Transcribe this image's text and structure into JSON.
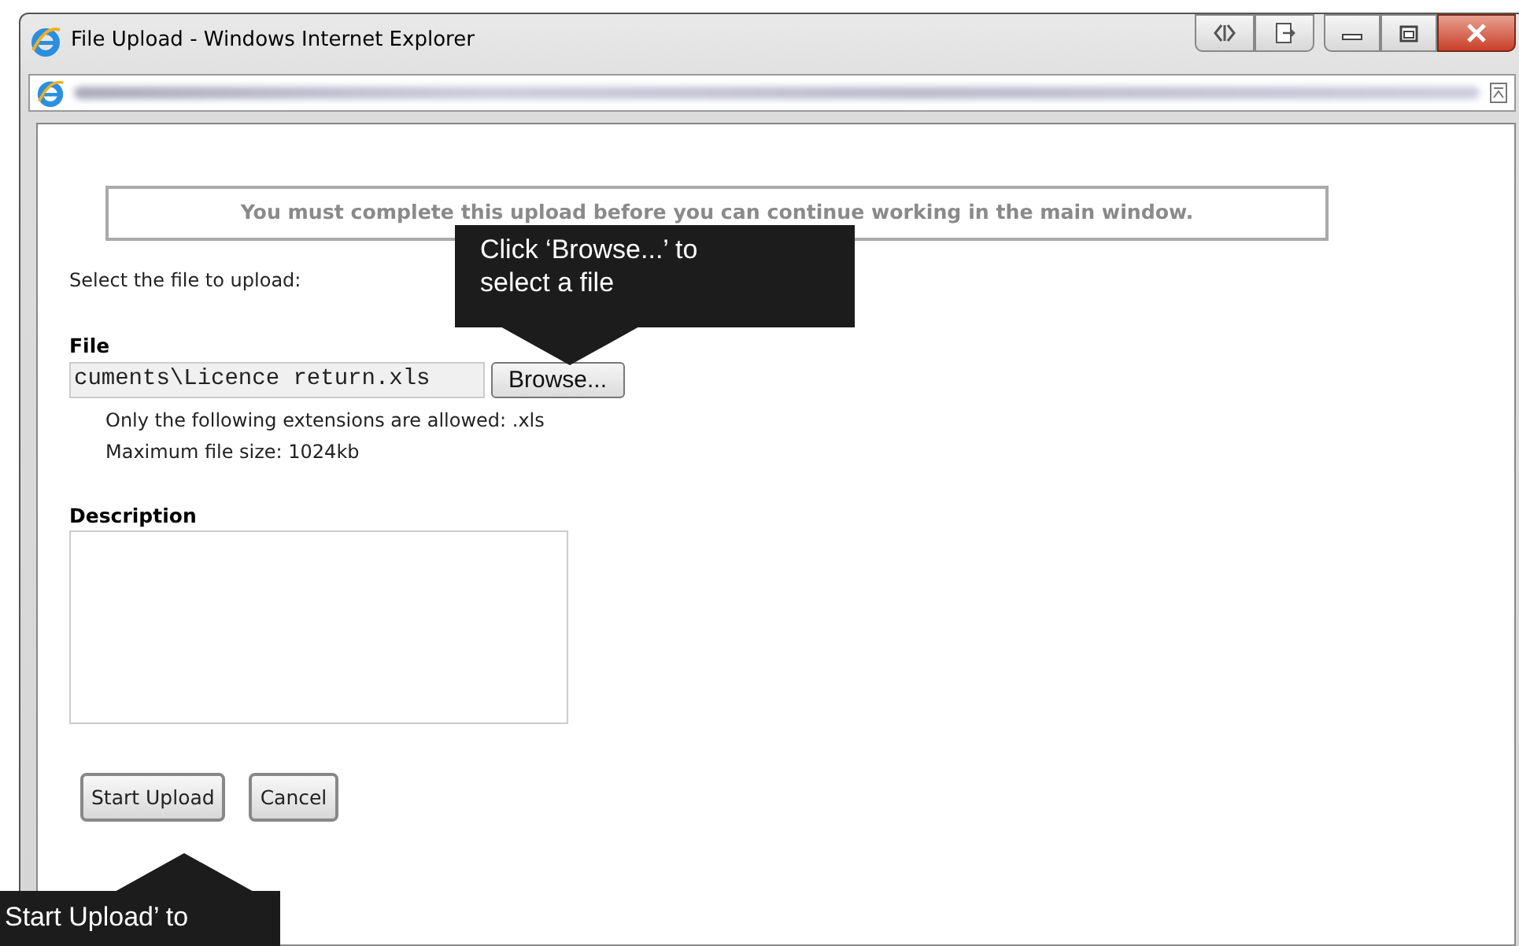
{
  "window": {
    "title": "File Upload - Windows Internet Explorer"
  },
  "notice": "You must complete this upload before you can continue working in the main window.",
  "instruction": "Select the file to upload:",
  "file": {
    "label": "File",
    "value": "cuments\\Licence return.xls",
    "button": "Browse...",
    "hints": [
      "Only the following extensions are allowed: .xls",
      "Maximum file size: 1024kb"
    ]
  },
  "description": {
    "label": "Description"
  },
  "buttons": [
    "Start Upload",
    "Cancel"
  ],
  "callouts": [
    {
      "text": "Click ‘Browse...’ to select a file"
    },
    {
      "text": "Start Upload’ to"
    }
  ]
}
